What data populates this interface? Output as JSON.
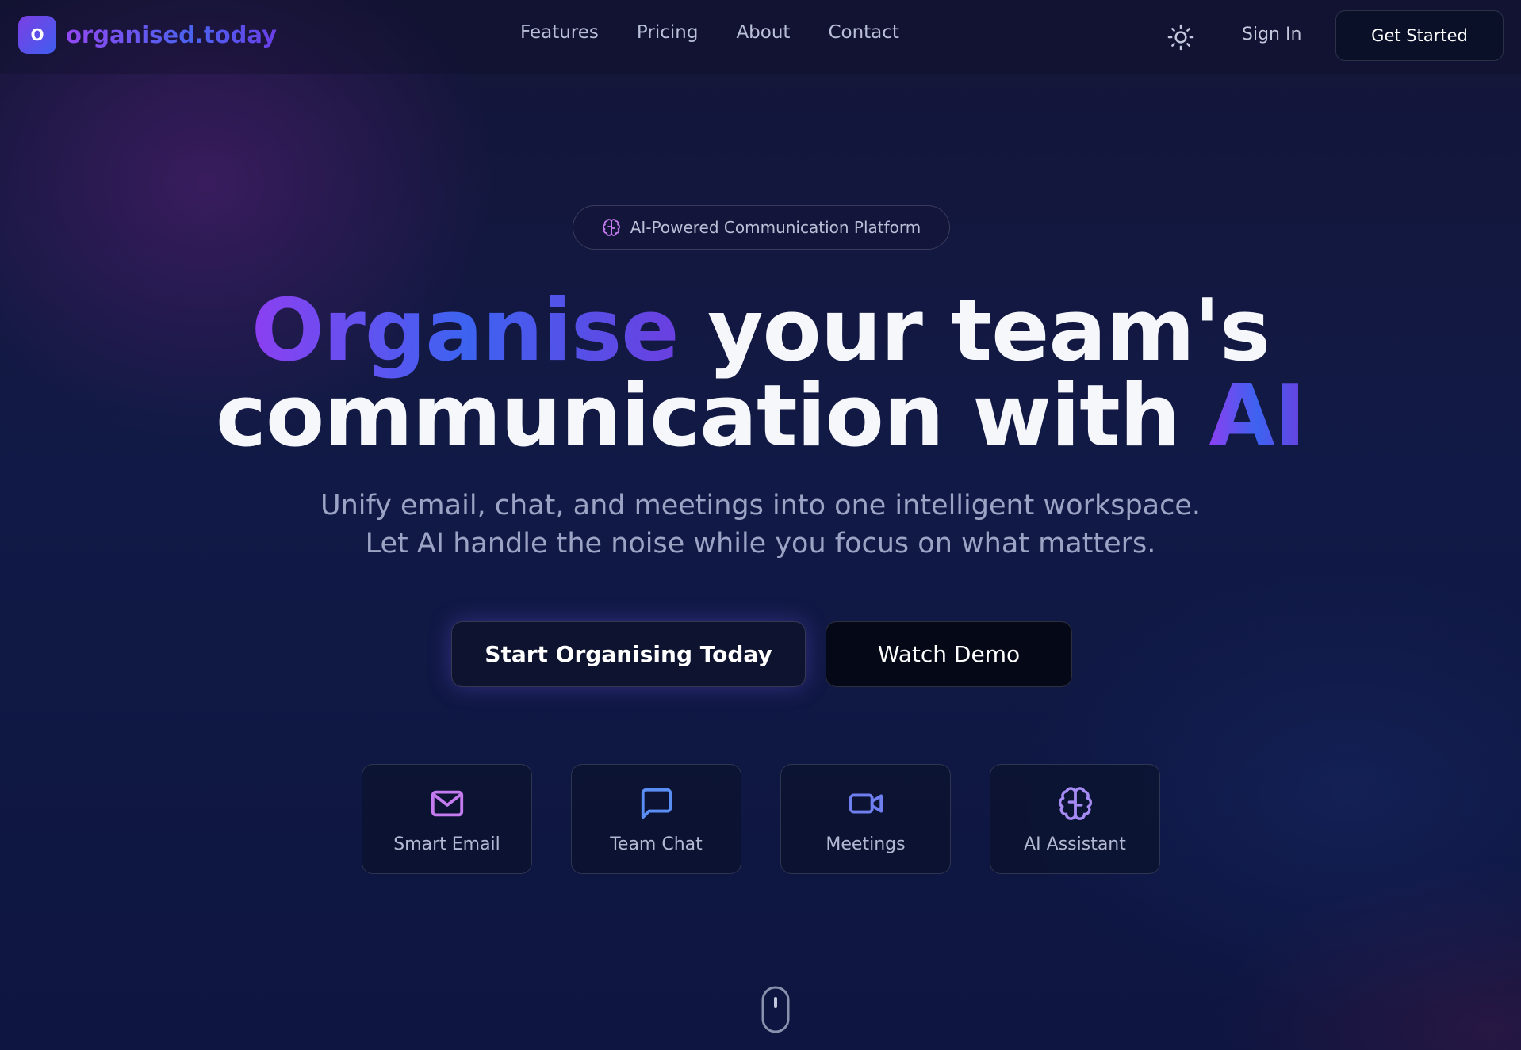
{
  "brand": {
    "logo_letter": "O",
    "name": "organised.today"
  },
  "nav": {
    "links": [
      {
        "label": "Features"
      },
      {
        "label": "Pricing"
      },
      {
        "label": "About"
      },
      {
        "label": "Contact"
      }
    ],
    "theme_icon": "sun-icon",
    "sign_in": "Sign In",
    "get_started": "Get Started"
  },
  "hero": {
    "badge_icon": "brain-icon",
    "badge": "AI-Powered Communication Platform",
    "headline_highlight_1": "Organise",
    "headline_mid": " your team's",
    "headline_line2": "communication with ",
    "headline_highlight_2": "AI",
    "subtitle": "Unify email, chat, and meetings into one intelligent workspace. Let AI handle the noise while you focus on what matters.",
    "cta_primary": "Start Organising Today",
    "cta_secondary": "Watch Demo"
  },
  "features": [
    {
      "label": "Smart Email",
      "icon": "mail-icon",
      "color": "#c57bf0"
    },
    {
      "label": "Team Chat",
      "icon": "message-square-icon",
      "color": "#5b8ef5"
    },
    {
      "label": "Meetings",
      "icon": "video-icon",
      "color": "#6f7ff0"
    },
    {
      "label": "AI Assistant",
      "icon": "brain-icon",
      "color": "#a78bf5"
    }
  ],
  "colors": {
    "accent_purple": "#8b3ff0",
    "accent_blue": "#3d63f0",
    "background": "#111a46"
  },
  "scroll_indicator_icon": "mouse-scroll-icon"
}
